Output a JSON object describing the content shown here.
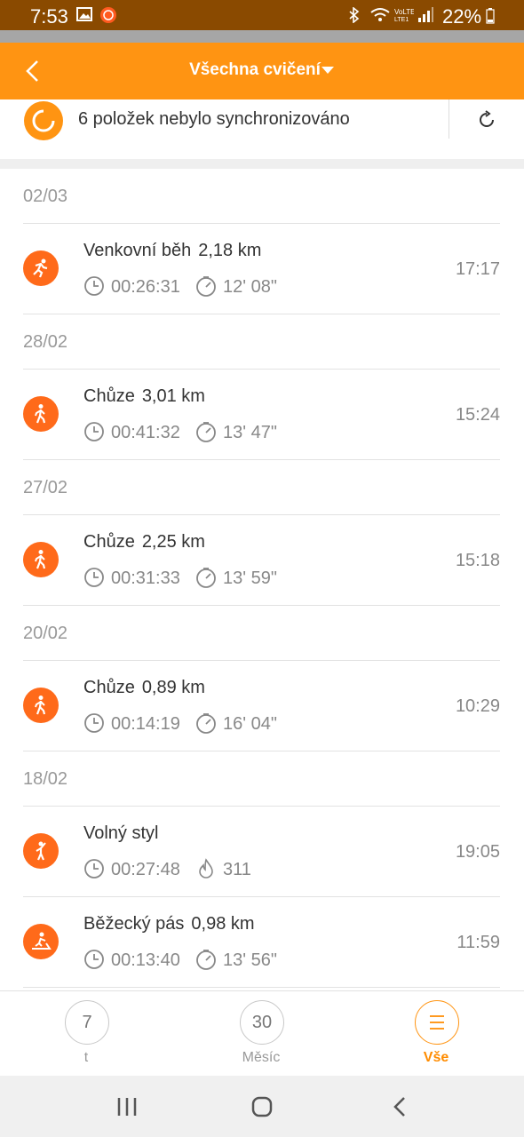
{
  "status_bar": {
    "time": "7:53",
    "battery": "22%"
  },
  "header": {
    "title": "Všechna cvičení"
  },
  "sync_banner": {
    "text": "6 položek nebylo synchronizováno"
  },
  "groups": [
    {
      "date": "02/03",
      "items": [
        {
          "activity": "Venkovní běh",
          "distance": "2,18 km",
          "duration": "00:26:31",
          "second_metric": "12' 08\"",
          "second_metric_icon": "pace-icon",
          "time": "17:17",
          "activity_icon": "running-icon"
        }
      ]
    },
    {
      "date": "28/02",
      "items": [
        {
          "activity": "Chůze",
          "distance": "3,01 km",
          "duration": "00:41:32",
          "second_metric": "13' 47\"",
          "second_metric_icon": "pace-icon",
          "time": "15:24",
          "activity_icon": "walking-icon"
        }
      ]
    },
    {
      "date": "27/02",
      "items": [
        {
          "activity": "Chůze",
          "distance": "2,25 km",
          "duration": "00:31:33",
          "second_metric": "13' 59\"",
          "second_metric_icon": "pace-icon",
          "time": "15:18",
          "activity_icon": "walking-icon"
        }
      ]
    },
    {
      "date": "20/02",
      "items": [
        {
          "activity": "Chůze",
          "distance": "0,89 km",
          "duration": "00:14:19",
          "second_metric": "16' 04\"",
          "second_metric_icon": "pace-icon",
          "time": "10:29",
          "activity_icon": "walking-icon"
        }
      ]
    },
    {
      "date": "18/02",
      "items": [
        {
          "activity": "Volný styl",
          "distance": "",
          "duration": "00:27:48",
          "second_metric": "311",
          "second_metric_icon": "calories-icon",
          "time": "19:05",
          "activity_icon": "freestyle-icon"
        },
        {
          "activity": "Běžecký pás",
          "distance": "0,98 km",
          "duration": "00:13:40",
          "second_metric": "13' 56\"",
          "second_metric_icon": "pace-icon",
          "time": "11:59",
          "activity_icon": "treadmill-icon"
        }
      ]
    }
  ],
  "bottom_tabs": [
    {
      "icon_text": "7",
      "label": "t",
      "active": false
    },
    {
      "icon_text": "30",
      "label": "Měsíc",
      "active": false
    },
    {
      "icon_text": "",
      "label": "Vše",
      "active": true
    }
  ],
  "colors": {
    "accent": "#ff9412",
    "activity_icon": "#ff6a1a",
    "status_bar": "#8a4a00"
  }
}
